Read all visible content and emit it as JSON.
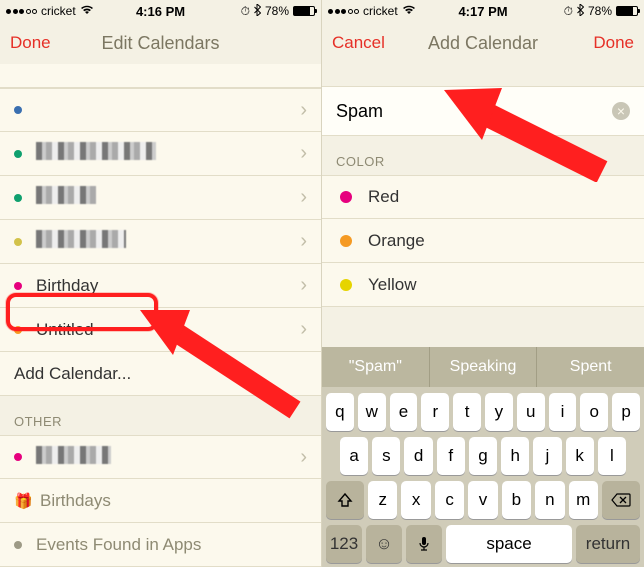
{
  "left": {
    "status": {
      "carrier": "cricket",
      "time": "4:16 PM",
      "battery_pct": "78%",
      "battery_fill": 78
    },
    "nav": {
      "left": "Done",
      "title": "Edit Calendars",
      "right": ""
    },
    "rows": [
      {
        "dot": "#3a6fb0",
        "pixelated": false,
        "width": "w100",
        "label_visible": false
      },
      {
        "dot": "#0fa06e",
        "pixelated": true,
        "width": "w100",
        "label": ""
      },
      {
        "dot": "#0fa06e",
        "pixelated": true,
        "width": "w60",
        "label": ""
      },
      {
        "dot": "#d2c24a",
        "pixelated": true,
        "width": "w80",
        "label": ""
      },
      {
        "dot": "#e6007e",
        "pixelated": false,
        "label": "Birthday"
      },
      {
        "dot": "#f59a23",
        "pixelated": false,
        "label": "Untitled"
      }
    ],
    "add_calendar": "Add Calendar...",
    "other_header": "OTHER",
    "other_rows": [
      {
        "dot": "#e6007e",
        "pixelated": true,
        "width": "w70"
      }
    ],
    "birthdays": "Birthdays",
    "events_found": "Events Found in Apps"
  },
  "right": {
    "status": {
      "carrier": "cricket",
      "time": "4:17 PM",
      "battery_pct": "78%",
      "battery_fill": 78
    },
    "nav": {
      "left": "Cancel",
      "title": "Add Calendar",
      "right": "Done"
    },
    "input_value": "Spam",
    "color_header": "COLOR",
    "colors": [
      {
        "hex": "#e6007e",
        "name": "Red"
      },
      {
        "hex": "#f59a23",
        "name": "Orange"
      },
      {
        "hex": "#e6d400",
        "name": "Yellow"
      }
    ],
    "suggestions": [
      "\"Spam\"",
      "Speaking",
      "Spent"
    ],
    "keys_r1": [
      "q",
      "w",
      "e",
      "r",
      "t",
      "y",
      "u",
      "i",
      "o",
      "p"
    ],
    "keys_r2": [
      "a",
      "s",
      "d",
      "f",
      "g",
      "h",
      "j",
      "k",
      "l"
    ],
    "keys_r3": [
      "z",
      "x",
      "c",
      "v",
      "b",
      "n",
      "m"
    ],
    "key_123": "123",
    "key_space": "space",
    "key_return": "return"
  }
}
